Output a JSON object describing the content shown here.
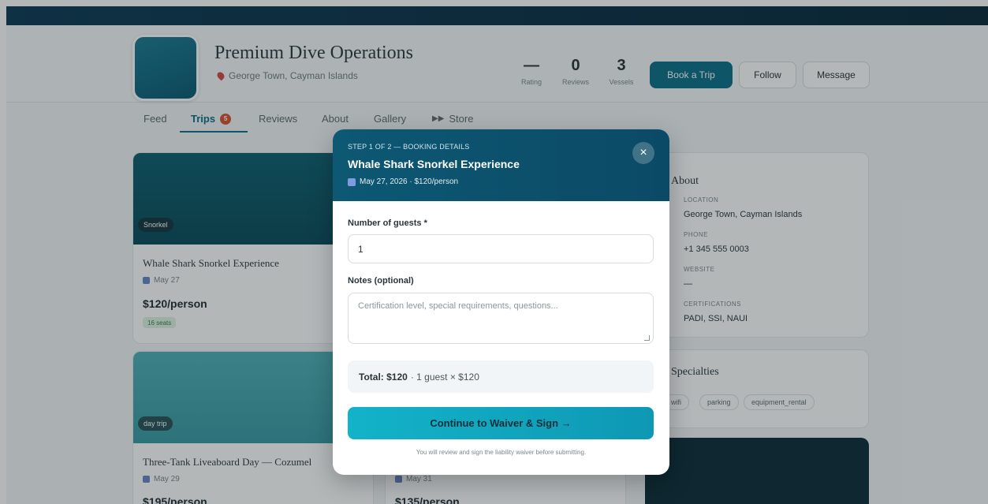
{
  "profile": {
    "name": "Premium Dive Operations",
    "location": "George Town, Cayman Islands",
    "stats": [
      {
        "value": "—",
        "label": "Rating"
      },
      {
        "value": "0",
        "label": "Reviews"
      },
      {
        "value": "3",
        "label": "Vessels"
      }
    ],
    "buttons": {
      "book": "Book a Trip",
      "follow": "Follow",
      "message": "Message"
    }
  },
  "tabs": {
    "feed": "Feed",
    "trips": "Trips",
    "trips_count": "5",
    "reviews": "Reviews",
    "about": "About",
    "gallery": "Gallery",
    "store_icon": "▶▶",
    "store": "Store"
  },
  "trips": [
    {
      "chip": "Snorkel",
      "title": "Whale Shark Snorkel Experience",
      "date": "May 27",
      "price": "$120/person",
      "seats": "16 seats"
    },
    {
      "chip": "day trip",
      "title": "Three-Tank Liveaboard Day — Cozumel",
      "date": "May 29",
      "price": "$195/person"
    },
    {
      "date": "May 31",
      "price": "$135/person"
    }
  ],
  "about": {
    "heading": "About",
    "location_label": "LOCATION",
    "location": "George Town, Cayman Islands",
    "phone_label": "PHONE",
    "phone": "+1 345 555 0003",
    "website_label": "WEBSITE",
    "website": "—",
    "cert_label": "CERTIFICATIONS",
    "certifications": "PADI, SSI, NAUI"
  },
  "specialties": {
    "heading": "Specialties",
    "tags": [
      "wifi",
      "parking",
      "equipment_rental"
    ]
  },
  "modal": {
    "step": "STEP 1 OF 2 — BOOKING DETAILS",
    "title": "Whale Shark Snorkel Experience",
    "subtitle": "May 27, 2026 · $120/person",
    "close": "×",
    "guests_label": "Number of guests *",
    "guests_value": "1",
    "notes_label": "Notes (optional)",
    "notes_placeholder": "Certification level, special requirements, questions...",
    "total_label": "Total: $120",
    "total_detail": "· 1 guest × $120",
    "continue": "Continue to Waiver & Sign →",
    "footnote": "You will review and sign the liability waiver before submitting."
  }
}
